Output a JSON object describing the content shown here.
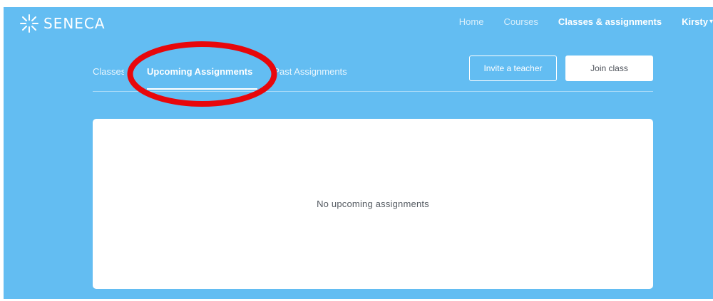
{
  "app": {
    "brand": "SENECA",
    "logo_icon": "spark-icon"
  },
  "topnav": {
    "items": [
      "Home",
      "Courses",
      "Classes & assignments"
    ],
    "user": "Kirsty",
    "caret_icon": "chevron-down-icon"
  },
  "tabs": {
    "items": [
      "Classes",
      "Upcoming Assignments",
      "Past Assignments"
    ],
    "active": "Upcoming Assignments"
  },
  "actions": {
    "invite_label": "Invite a teacher",
    "join_label": "Join class"
  },
  "main": {
    "empty_message": "No upcoming assignments"
  },
  "colors": {
    "background": "#63bdf2",
    "card": "#ffffff",
    "highlight": "#e8070b"
  }
}
